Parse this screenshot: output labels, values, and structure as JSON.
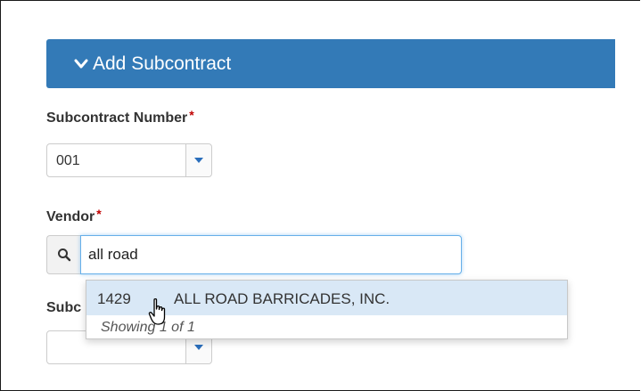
{
  "panel": {
    "title": "Add Subcontract",
    "chevron_icon": "chevron-down-icon"
  },
  "subcontract_number": {
    "label": "Subcontract Number",
    "required_mark": "*",
    "value": "001"
  },
  "vendor": {
    "label": "Vendor",
    "required_mark": "*",
    "search_icon": "search-icon",
    "query": "all road"
  },
  "autocomplete": {
    "results": [
      {
        "code": "1429",
        "name": "ALL ROAD BARRICADES, INC."
      }
    ],
    "footer": "Showing 1 of 1"
  },
  "third_field": {
    "label": "Subc",
    "value": ""
  },
  "colors": {
    "header_bg": "#337ab7",
    "required": "#c00000",
    "highlight": "#d9e8f6",
    "focus_border": "#66afe9"
  }
}
